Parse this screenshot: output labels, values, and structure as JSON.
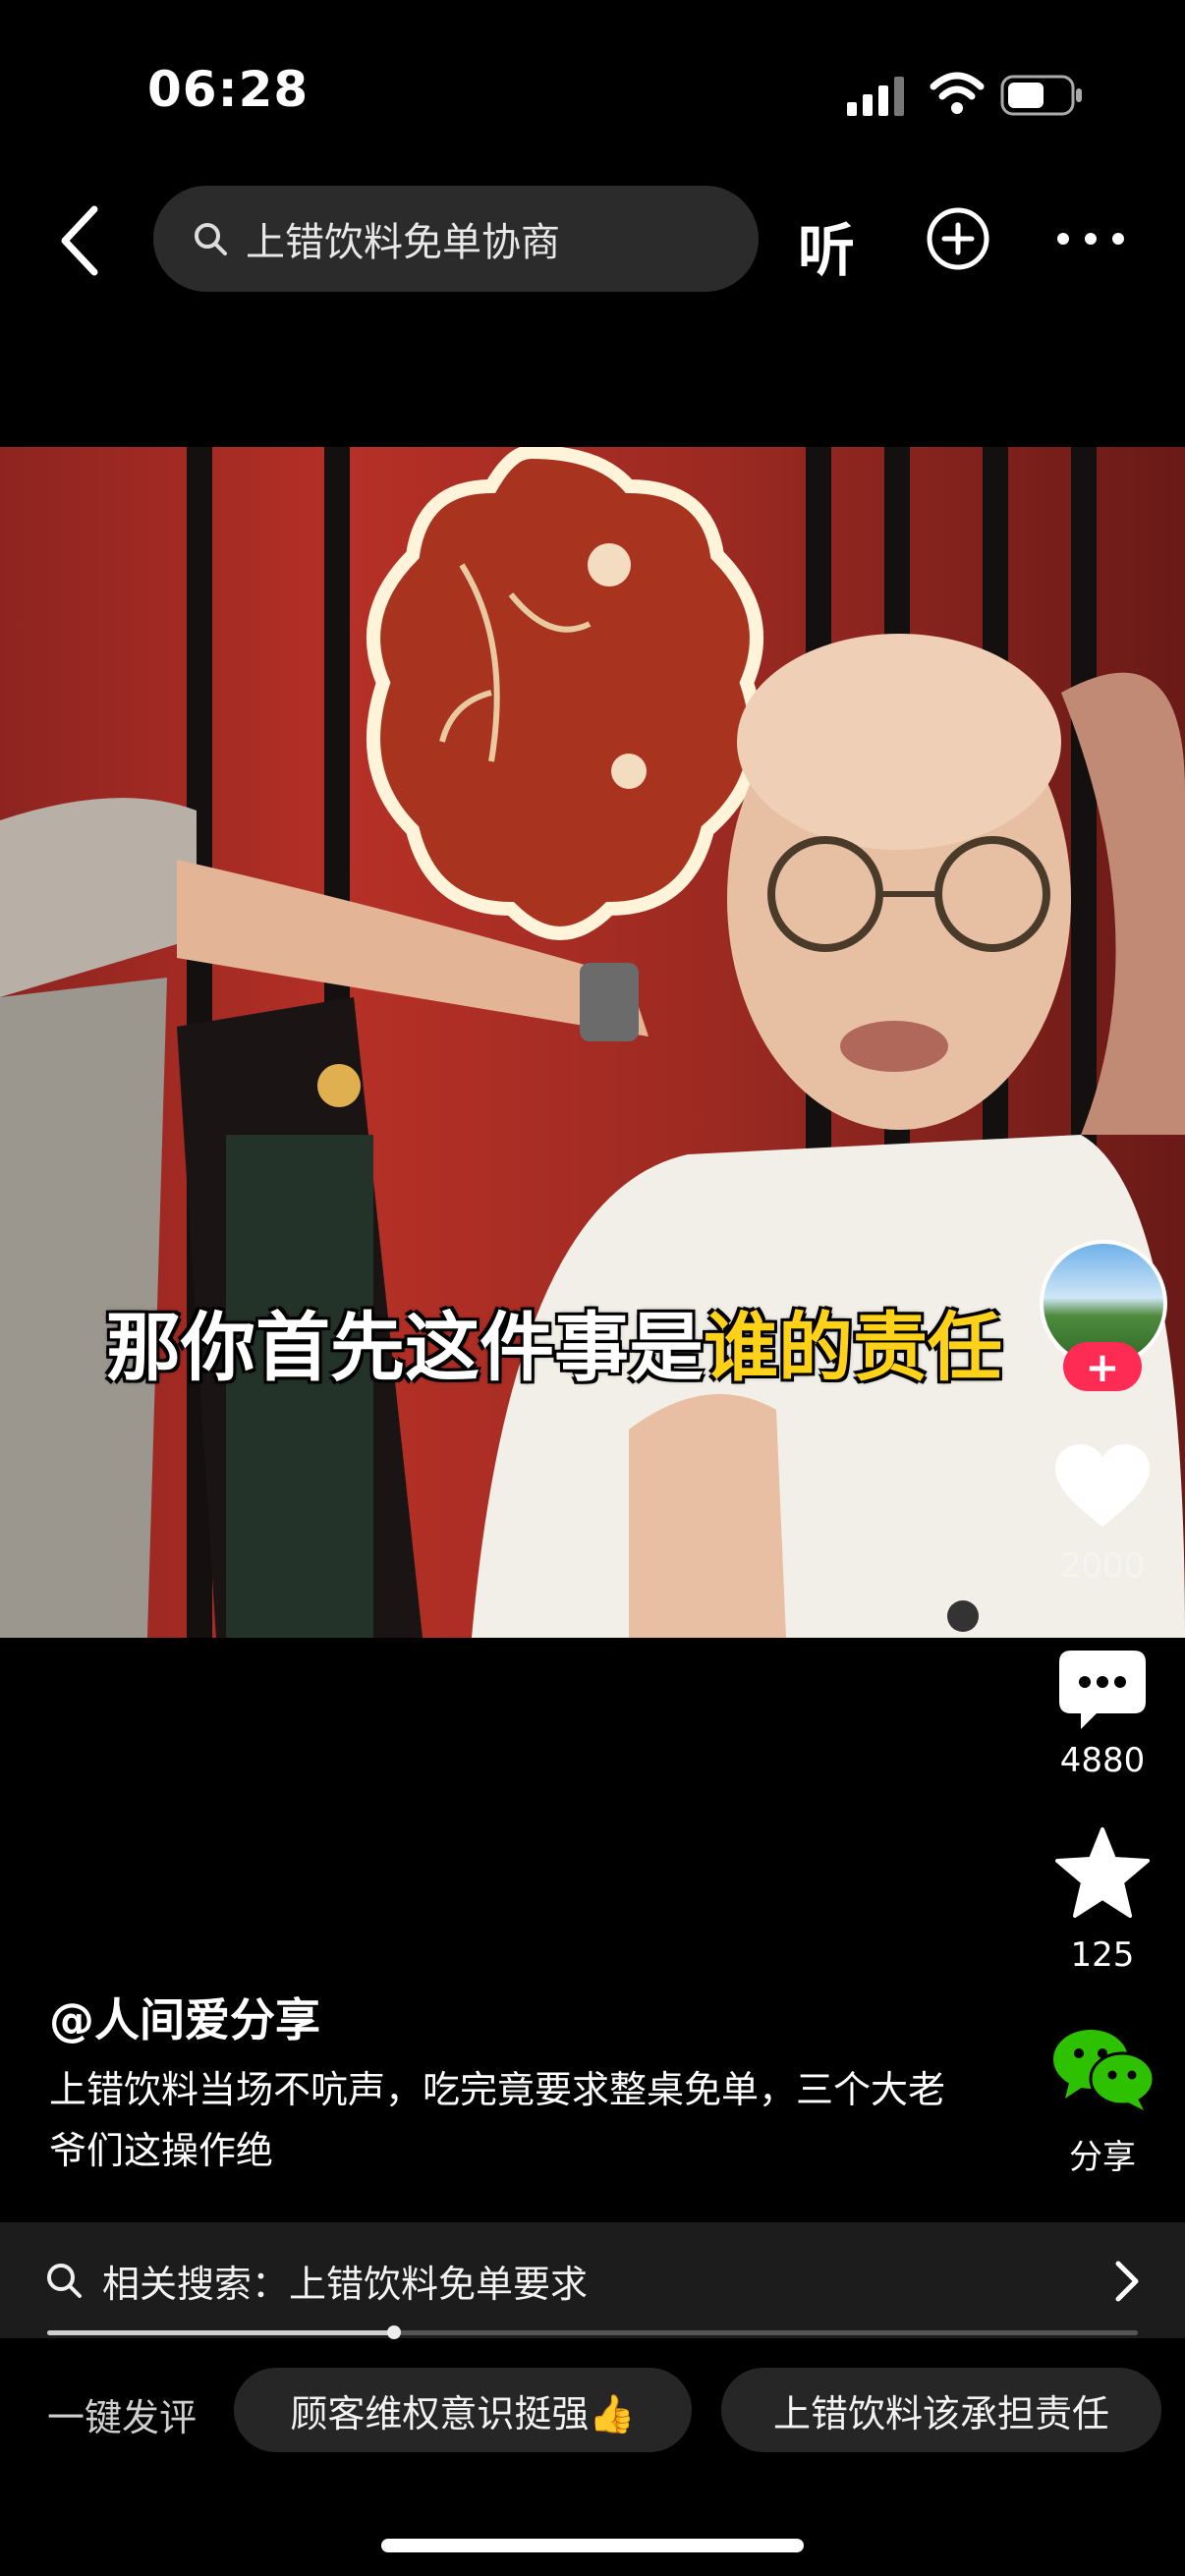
{
  "status_bar": {
    "time": "06:28"
  },
  "top_bar": {
    "search_text": "上错饮料免单协商",
    "listen_label": "听"
  },
  "video": {
    "subtitle_normal": "那你首先这件事是",
    "subtitle_highlight": "谁的责任",
    "highlight_color": "#ffd21a"
  },
  "actions": {
    "like_count": "2000",
    "comment_count": "4880",
    "favorite_count": "125",
    "share_label": "分享",
    "follow_symbol": "+"
  },
  "caption": {
    "author": "@人间爱分享",
    "description": "上错饮料当场不吭声，吃完竟要求整桌免单，三个大老爷们这操作绝"
  },
  "related_search": {
    "text": "相关搜索：上错饮料免单要求"
  },
  "progress": {
    "played_fraction": 0.318
  },
  "quick_comment": {
    "label": "一键发评",
    "chips": [
      "顾客维权意识挺强👍",
      "上错饮料该承担责任"
    ]
  },
  "colors": {
    "accent_red": "#fe2c55",
    "chip_bg": "#262626"
  }
}
